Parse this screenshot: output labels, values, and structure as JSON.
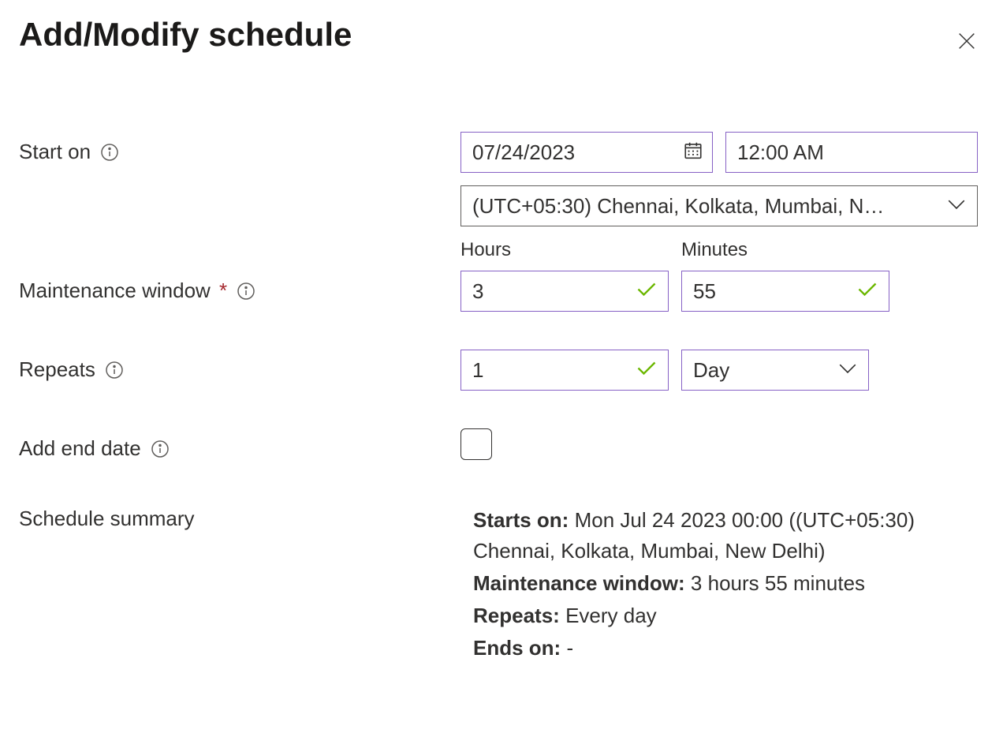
{
  "title": "Add/Modify schedule",
  "labels": {
    "start_on": "Start on",
    "maintenance_window": "Maintenance window",
    "repeats": "Repeats",
    "add_end_date": "Add end date",
    "schedule_summary": "Schedule summary",
    "hours": "Hours",
    "minutes": "Minutes"
  },
  "values": {
    "date": "07/24/2023",
    "time": "12:00 AM",
    "timezone": "(UTC+05:30) Chennai, Kolkata, Mumbai, N…",
    "hours": "3",
    "minutes": "55",
    "repeat_count": "1",
    "repeat_unit": "Day",
    "add_end_date_checked": false
  },
  "summary": {
    "starts_on_label": "Starts on:",
    "starts_on_value": "Mon Jul 24 2023 00:00 ((UTC+05:30) Chennai, Kolkata, Mumbai, New Delhi)",
    "maintenance_window_label": "Maintenance window:",
    "maintenance_window_value": "3 hours 55 minutes",
    "repeats_label": "Repeats:",
    "repeats_value": "Every day",
    "ends_on_label": "Ends on:",
    "ends_on_value": "-"
  }
}
